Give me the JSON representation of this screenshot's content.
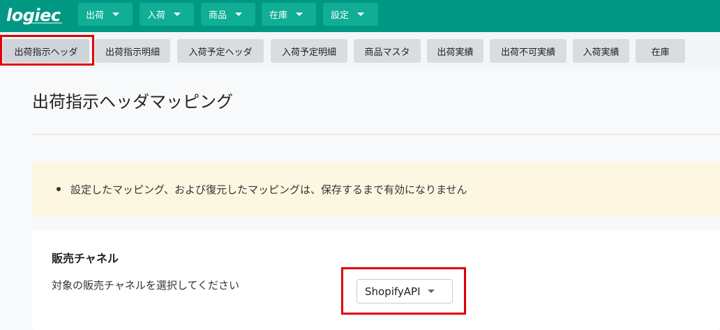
{
  "app": {
    "logo_text": "logiec"
  },
  "nav": {
    "menus": [
      {
        "label": "出荷"
      },
      {
        "label": "入荷"
      },
      {
        "label": "商品"
      },
      {
        "label": "在庫"
      },
      {
        "label": "設定"
      }
    ]
  },
  "tabs": [
    {
      "label": "出荷指示ヘッダ",
      "active": true
    },
    {
      "label": "出荷指示明細"
    },
    {
      "label": "入荷予定ヘッダ"
    },
    {
      "label": "入荷予定明細"
    },
    {
      "label": "商品マスタ"
    },
    {
      "label": "出荷実績"
    },
    {
      "label": "出荷不可実績"
    },
    {
      "label": "入荷実績"
    },
    {
      "label": "在庫"
    }
  ],
  "page": {
    "title": "出荷指示ヘッダマッピング"
  },
  "alert": {
    "message": "設定したマッピング、および復元したマッピングは、保存するまで有効になりません"
  },
  "sales_channel": {
    "title": "販売チャネル",
    "description": "対象の販売チャネルを選択してください",
    "selected": "ShopifyAPI"
  },
  "colors": {
    "nav_bg": "#009883",
    "nav_button": "#0fae95",
    "highlight": "#e00000",
    "alert_bg": "#fdf7e1"
  }
}
